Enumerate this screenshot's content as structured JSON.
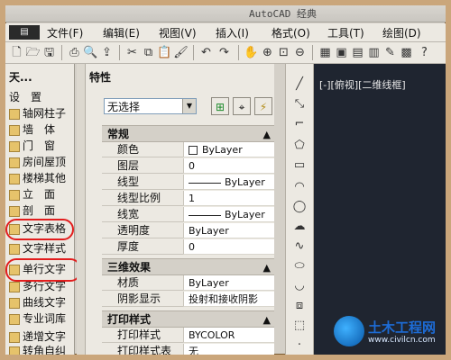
{
  "window": {
    "title": "AutoCAD 经典"
  },
  "menubar": {
    "items": [
      "文件(F)",
      "编辑(E)",
      "视图(V)",
      "插入(I)",
      "格式(O)",
      "工具(T)",
      "绘图(D)"
    ]
  },
  "left_palette": {
    "header": "天...",
    "items": [
      "设　置",
      "轴网柱子",
      "墙　体",
      "门　窗",
      "房间屋顶",
      "楼梯其他",
      "立　面",
      "剖　面",
      "文字表格",
      "文字样式",
      "单行文字",
      "多行文字",
      "曲线文字",
      "专业词库",
      "递增文字",
      "转角自纠"
    ]
  },
  "properties": {
    "title": "特性",
    "selection": "无选择",
    "sections": {
      "general": "常规",
      "three_d": "三维效果",
      "print": "打印样式"
    },
    "general_rows": [
      {
        "label": "颜色",
        "value": "ByLayer"
      },
      {
        "label": "图层",
        "value": "0"
      },
      {
        "label": "线型",
        "value": "ByLayer"
      },
      {
        "label": "线型比例",
        "value": "1"
      },
      {
        "label": "线宽",
        "value": "ByLayer"
      },
      {
        "label": "透明度",
        "value": "ByLayer"
      },
      {
        "label": "厚度",
        "value": "0"
      }
    ],
    "three_d_rows": [
      {
        "label": "材质",
        "value": "ByLayer"
      },
      {
        "label": "阴影显示",
        "value": "投射和接收阴影"
      }
    ],
    "print_rows": [
      {
        "label": "打印样式",
        "value": "BYCOLOR"
      },
      {
        "label": "打印样式表",
        "value": "无"
      }
    ]
  },
  "canvas": {
    "view_label": "[-][俯视][二维线框]"
  },
  "watermark": {
    "title": "土木工程网",
    "url": "www.civilcn.com"
  },
  "colors": {
    "highlight": "#e21d1d",
    "canvas_bg": "#1f2530"
  }
}
